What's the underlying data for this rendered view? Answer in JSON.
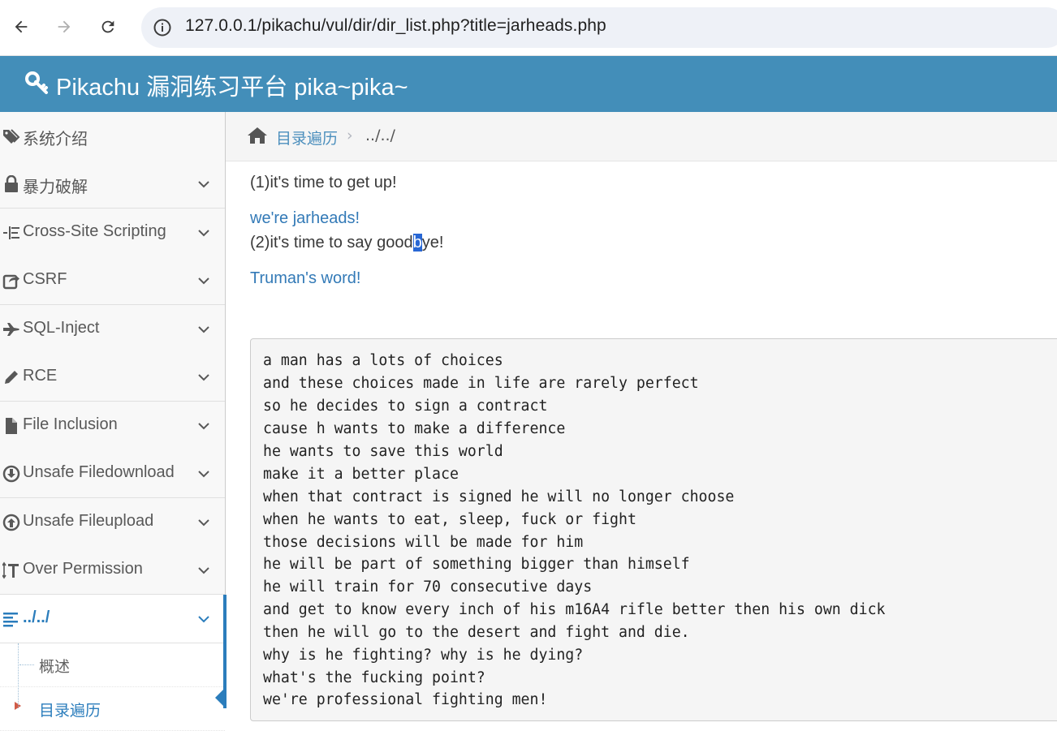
{
  "browser": {
    "url": "127.0.0.1/pikachu/vul/dir/dir_list.php?title=jarheads.php"
  },
  "header": {
    "title": "Pikachu 漏洞练习平台 pika~pika~"
  },
  "sidebar": {
    "items": [
      {
        "label": "系统介绍",
        "icon": "tags-icon"
      },
      {
        "label": "暴力破解",
        "icon": "lock-icon"
      },
      {
        "label": "Cross-Site Scripting",
        "icon": "list-tree-icon"
      },
      {
        "label": "CSRF",
        "icon": "share-square-icon"
      },
      {
        "label": "SQL-Inject",
        "icon": "fighter-jet-icon"
      },
      {
        "label": "RCE",
        "icon": "pencil-icon"
      },
      {
        "label": "File Inclusion",
        "icon": "file-icon"
      },
      {
        "label": "Unsafe Filedownload",
        "icon": "download-circle-icon"
      },
      {
        "label": "Unsafe Fileupload",
        "icon": "upload-circle-icon"
      },
      {
        "label": "Over Permission",
        "icon": "text-height-icon"
      },
      {
        "label": "../../",
        "icon": "align-left-icon",
        "active": true
      }
    ],
    "submenu": [
      {
        "label": "概述"
      },
      {
        "label": "目录遍历",
        "current": true
      }
    ]
  },
  "breadcrumb": {
    "link": "目录遍历",
    "separator": "›",
    "current": "../../"
  },
  "main": {
    "line1": "(1)it's time to get up!",
    "link1": "we're jarheads!",
    "line2_before": "(2)it's time to say good",
    "line2_selected": "b",
    "line2_after": "ye!",
    "link2": "Truman's word!",
    "pre_lines": [
      "a man has a lots of choices",
      "and these choices made in life are rarely perfect",
      "so he decides to sign a contract",
      "cause h wants to make a difference",
      "he wants to save this world",
      "make it a better place",
      "when that contract is signed he will no longer choose",
      "when he wants to eat, sleep, fuck or fight",
      "those decisions will be made for him",
      "he will be part of something bigger than himself",
      "he will train for 70 consecutive days",
      "and get to know every inch of his m16A4 rifle better then his own dick",
      "then he will go to the desert and fight and die.",
      "why is he fighting? why is he dying?",
      "what's the fucking point?",
      "we're professional fighting men!"
    ]
  },
  "colors": {
    "header_bg": "#438eb9",
    "link": "#337ab7",
    "active": "#2b7dbc",
    "selection": "#2867d4"
  }
}
